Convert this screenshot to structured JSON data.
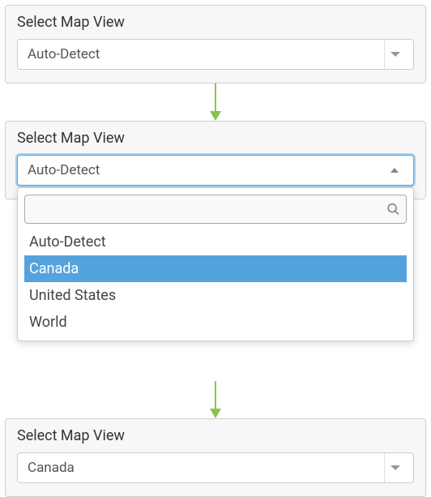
{
  "panel1": {
    "label": "Select Map View",
    "selected": "Auto-Detect"
  },
  "panel2": {
    "label": "Select Map View",
    "selected": "Auto-Detect",
    "search_placeholder": "",
    "options": [
      "Auto-Detect",
      "Canada",
      "United States",
      "World"
    ],
    "highlighted_index": 1
  },
  "panel3": {
    "label": "Select Map View",
    "selected": "Canada"
  },
  "colors": {
    "highlight": "#55a3dd",
    "arrow": "#8bc34a"
  }
}
